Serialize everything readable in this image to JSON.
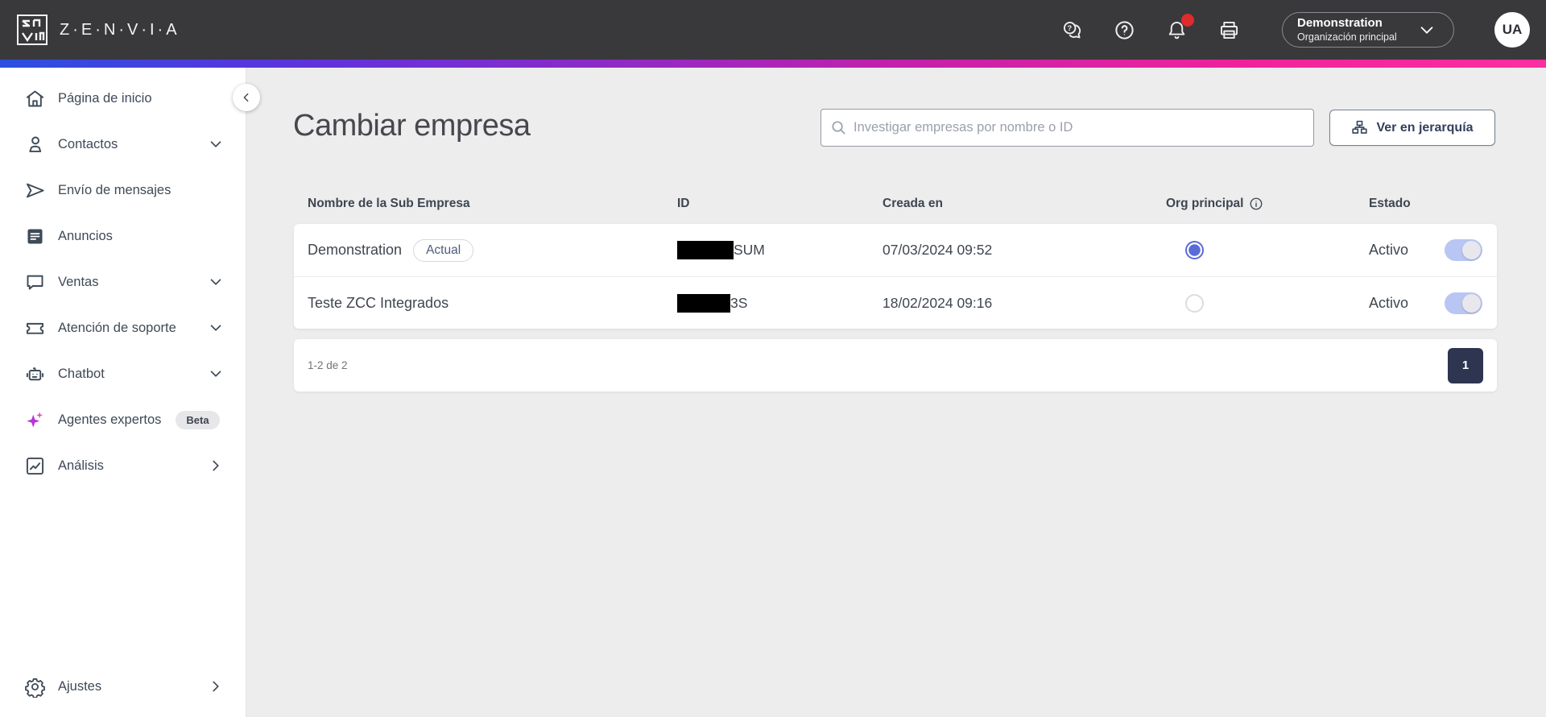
{
  "topbar": {
    "brand": "Z·E·N·V·I·A",
    "icons": [
      "chat-question-icon",
      "help-icon",
      "notifications-bell-icon",
      "printer-icon"
    ],
    "notification_dot": true,
    "org_switcher": {
      "name": "Demonstration",
      "subtitle": "Organización principal",
      "chevron": "down"
    },
    "avatar": "UA"
  },
  "sidebar": {
    "items": [
      {
        "label": "Página de inicio",
        "icon": "home-icon"
      },
      {
        "label": "Contactos",
        "icon": "contacts-icon",
        "chevron": "down"
      },
      {
        "label": "Envío de mensajes",
        "icon": "send-icon"
      },
      {
        "label": "Anuncios",
        "icon": "announcements-icon"
      },
      {
        "label": "Ventas",
        "icon": "sales-chat-icon",
        "chevron": "down"
      },
      {
        "label": "Atención de soporte",
        "icon": "support-ticket-icon",
        "chevron": "down"
      },
      {
        "label": "Chatbot",
        "icon": "robot-icon",
        "chevron": "down"
      },
      {
        "label": "Agentes expertos",
        "icon": "sparkles-icon",
        "badge": "Beta"
      },
      {
        "label": "Análisis",
        "icon": "analytics-icon",
        "chevron": "right"
      }
    ],
    "bottom_item": {
      "label": "Ajustes",
      "icon": "gear-icon",
      "chevron": "right"
    }
  },
  "main": {
    "title": "Cambiar empresa",
    "search": {
      "placeholder": "Investigar empresas por nombre o ID"
    },
    "hierarchy_button_label": "Ver en jerarquía",
    "table": {
      "headers": [
        "Nombre de la Sub Empresa",
        "ID",
        "Creada en",
        "Org principal",
        "Estado"
      ],
      "rows": [
        {
          "name": "Demonstration",
          "badge": "Actual",
          "id_redacted": true,
          "id_suffix": "SUM",
          "created": "07/03/2024 09:52",
          "org_principal": true,
          "status": "Activo",
          "toggle_on": true
        },
        {
          "name": "Teste ZCC Integrados",
          "badge": null,
          "id_redacted": true,
          "id_suffix": "3S",
          "created": "18/02/2024 09:16",
          "org_principal": false,
          "status": "Activo",
          "toggle_on": true
        }
      ],
      "pagination": {
        "range_label": "1-2 de 2",
        "page": "1"
      }
    }
  },
  "colors": {
    "topbar_bg": "#39393b",
    "page_bg": "#ededee",
    "accent_radio": "#5a6bd8",
    "toggle_track": "#b9c6f3",
    "pagination_button": "#2d3550",
    "notification_red": "#de2b2b",
    "gradient": [
      "#2b50e0",
      "#5a34dd",
      "#8a2bc8",
      "#c321ab",
      "#fb2f9f"
    ]
  }
}
